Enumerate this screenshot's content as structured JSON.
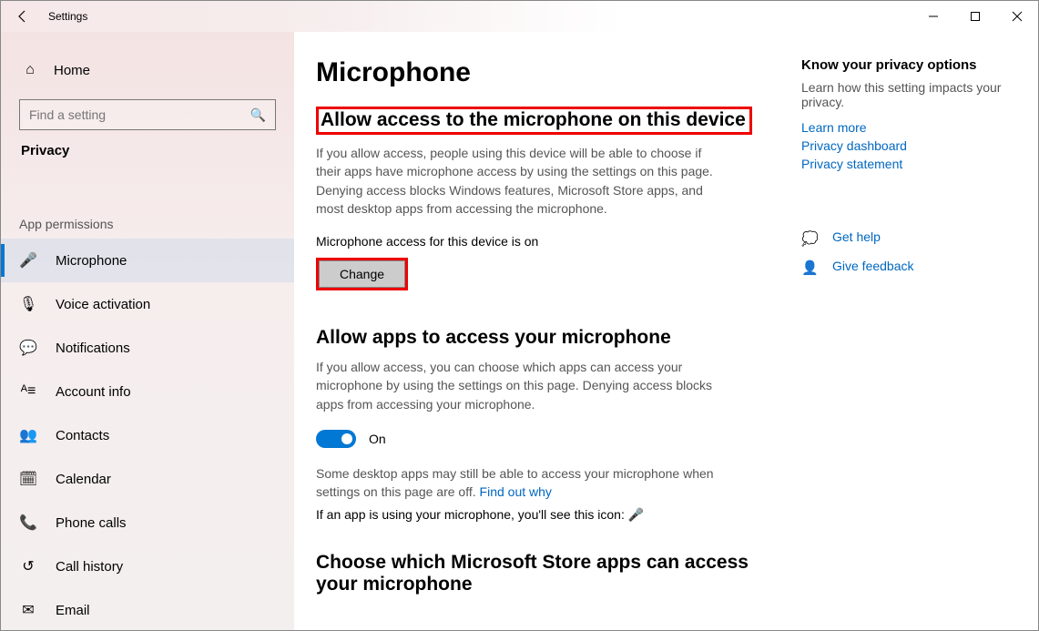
{
  "titlebar": {
    "title": "Settings"
  },
  "sidebar": {
    "home": "Home",
    "search_placeholder": "Find a setting",
    "category": "Privacy",
    "section": "App permissions",
    "items": [
      {
        "icon": "microphone-icon",
        "label": "Microphone"
      },
      {
        "icon": "voice-icon",
        "label": "Voice activation"
      },
      {
        "icon": "notifications-icon",
        "label": "Notifications"
      },
      {
        "icon": "account-icon",
        "label": "Account info"
      },
      {
        "icon": "contacts-icon",
        "label": "Contacts"
      },
      {
        "icon": "calendar-icon",
        "label": "Calendar"
      },
      {
        "icon": "phone-icon",
        "label": "Phone calls"
      },
      {
        "icon": "history-icon",
        "label": "Call history"
      },
      {
        "icon": "email-icon",
        "label": "Email"
      }
    ]
  },
  "main": {
    "title": "Microphone",
    "h2_device": "Allow access to the microphone on this device",
    "p_device": "If you allow access, people using this device will be able to choose if their apps have microphone access by using the settings on this page. Denying access blocks Windows features, Microsoft Store apps, and most desktop apps from accessing the microphone.",
    "status": "Microphone access for this device is on",
    "change": "Change",
    "h2_apps": "Allow apps to access your microphone",
    "p_apps": "If you allow access, you can choose which apps can access your microphone by using the settings on this page. Denying access blocks apps from accessing your microphone.",
    "toggle_on": "On",
    "p_desktop": "Some desktop apps may still be able to access your microphone when settings on this page are off. ",
    "find_out": "Find out why",
    "p_icon": "If an app is using your microphone, you'll see this icon:",
    "h2_store": "Choose which Microsoft Store apps can access your microphone"
  },
  "right": {
    "h": "Know your privacy options",
    "p": "Learn how this setting impacts your privacy.",
    "links": [
      "Learn more",
      "Privacy dashboard",
      "Privacy statement"
    ],
    "help": "Get help",
    "feedback": "Give feedback"
  }
}
